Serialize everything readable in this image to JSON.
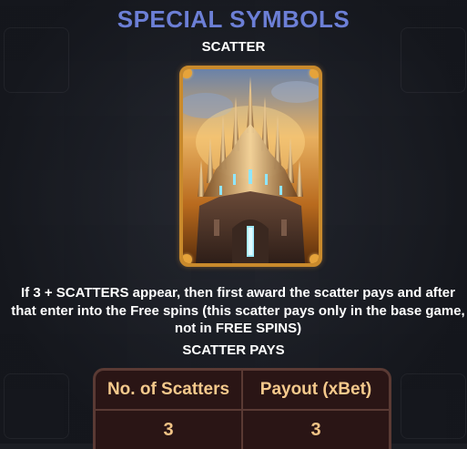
{
  "header": {
    "title": "SPECIAL SYMBOLS",
    "section": "SCATTER"
  },
  "symbol": {
    "icon": "castle-scatter-icon"
  },
  "description": "If 3 + SCATTERS appear, then first award the scatter pays and after that enter into the Free spins (this scatter pays only in the base game, not in FREE SPINS)",
  "pays": {
    "heading": "SCATTER PAYS",
    "columns": [
      "No. of Scatters",
      "Payout (xBet)"
    ],
    "rows": [
      [
        "3",
        "3"
      ]
    ]
  },
  "colors": {
    "title": "#6c7fd6",
    "table_text": "#f3c98a",
    "table_border": "#5a3a34",
    "card_frame": "#c98a2c"
  }
}
